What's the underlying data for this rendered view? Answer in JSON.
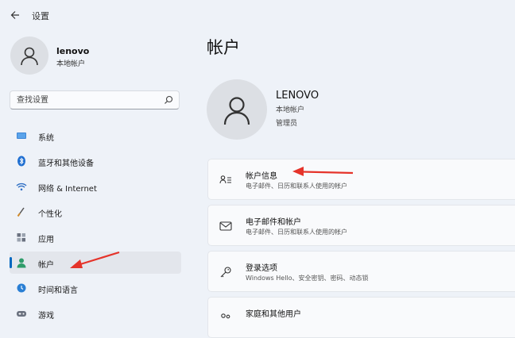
{
  "window": {
    "title": "设置"
  },
  "profile": {
    "name": "lenovo",
    "account_type": "本地帐户"
  },
  "search": {
    "placeholder": "查找设置"
  },
  "nav": {
    "items": [
      {
        "label": "系统",
        "icon": "monitor-icon"
      },
      {
        "label": "蓝牙和其他设备",
        "icon": "bluetooth-icon"
      },
      {
        "label": "网络 & Internet",
        "icon": "wifi-icon"
      },
      {
        "label": "个性化",
        "icon": "brush-icon"
      },
      {
        "label": "应用",
        "icon": "apps-icon"
      },
      {
        "label": "帐户",
        "icon": "person-icon",
        "selected": true
      },
      {
        "label": "时间和语言",
        "icon": "globe-clock-icon"
      },
      {
        "label": "游戏",
        "icon": "gamepad-icon"
      }
    ]
  },
  "main": {
    "title": "帐户",
    "user": {
      "name": "LENOVO",
      "account_type": "本地帐户",
      "role": "管理员"
    },
    "cards": [
      {
        "title": "帐户信息",
        "desc": "电子邮件、日历和联系人使用的帐户",
        "icon": "account-info-icon"
      },
      {
        "title": "电子邮件和帐户",
        "desc": "电子邮件、日历和联系人使用的帐户",
        "icon": "mail-icon"
      },
      {
        "title": "登录选项",
        "desc": "Windows Hello、安全密钥、密码、动态锁",
        "icon": "key-icon"
      },
      {
        "title": "家庭和其他用户",
        "desc": "",
        "icon": "family-icon"
      }
    ]
  },
  "colors": {
    "accent": "#0067c0",
    "annotation_arrow": "#e5332a",
    "background": "#eef2f8"
  }
}
